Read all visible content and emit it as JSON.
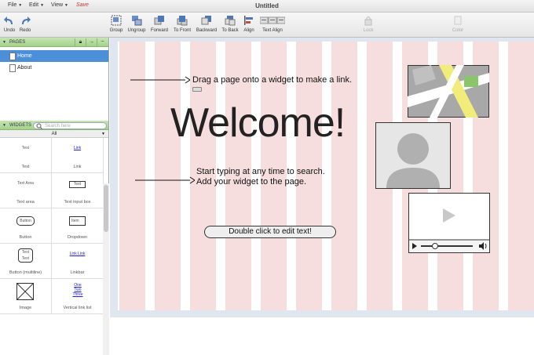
{
  "menubar": {
    "file": "File",
    "edit": "Edit",
    "view": "View",
    "save": "Save",
    "title": "Untitled"
  },
  "toolbar": {
    "undo": "Undo",
    "redo": "Redo",
    "group": "Group",
    "ungroup": "Ungroup",
    "forward": "Forward",
    "to_front": "To Front",
    "backward": "Backward",
    "to_back": "To Back",
    "align": "Align",
    "text_align": "Text Align",
    "lock": "Lock",
    "color": "Color"
  },
  "pages": {
    "header": "PAGES",
    "items": [
      "Home",
      "About"
    ]
  },
  "widgets": {
    "header": "WIDGETS",
    "search_placeholder": "Search here",
    "filter": "All",
    "items": [
      {
        "label": "Text",
        "preview": "Text"
      },
      {
        "label": "Link",
        "preview": "Link"
      },
      {
        "label": "Text area",
        "preview": "Text Area"
      },
      {
        "label": "Text input box",
        "preview": "Text"
      },
      {
        "label": "Button",
        "preview": "Button"
      },
      {
        "label": "Dropdown",
        "preview": "Item"
      },
      {
        "label": "Button (multiline)",
        "preview": "Text Text"
      },
      {
        "label": "Linkbar",
        "preview": "Link Link"
      },
      {
        "label": "Image",
        "preview": ""
      },
      {
        "label": "Vertical link list",
        "preview": "One Two Three"
      }
    ]
  },
  "canvas": {
    "hint_drag": "Drag a page onto a widget to make a link.",
    "welcome": "Welcome!",
    "hint_type_1": "Start typing at any time to search.",
    "hint_type_2": "Add your widget to the page.",
    "edit_button": "Double click to edit text!"
  }
}
